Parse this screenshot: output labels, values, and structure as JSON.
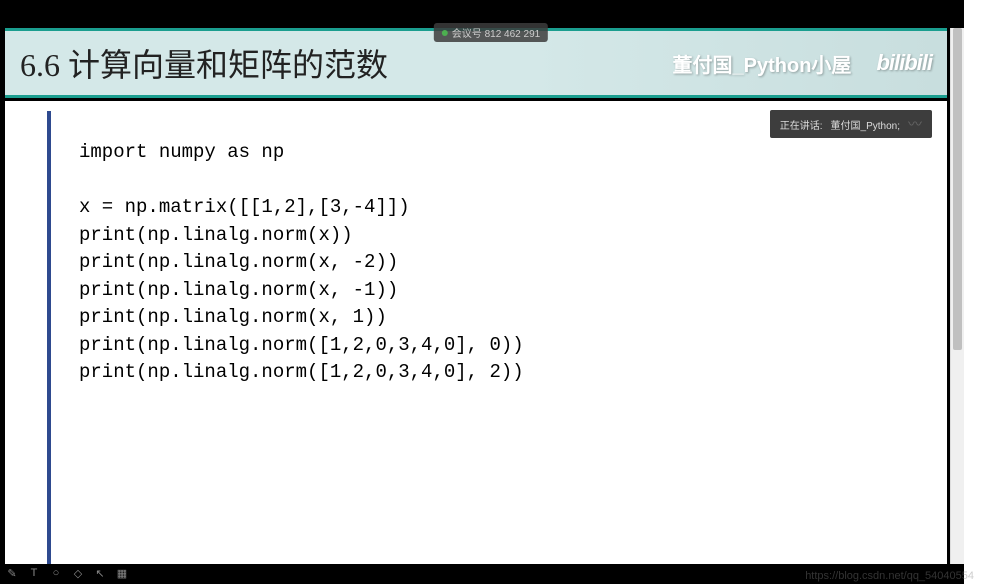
{
  "meeting": {
    "label": "会议号 812 462 291"
  },
  "header": {
    "title": "6.6  计算向量和矩阵的范数",
    "author": "董付国_Python小屋",
    "logo": "bilibili"
  },
  "speaking": {
    "prefix": "正在讲话:",
    "name": "董付国_Python;"
  },
  "code": {
    "content": "import numpy as np\n\nx = np.matrix([[1,2],[3,-4]])\nprint(np.linalg.norm(x))\nprint(np.linalg.norm(x, -2))\nprint(np.linalg.norm(x, -1))\nprint(np.linalg.norm(x, 1))\nprint(np.linalg.norm([1,2,0,3,4,0], 0))\nprint(np.linalg.norm([1,2,0,3,4,0], 2))"
  },
  "watermark": {
    "text": "https://blog.csdn.net/qq_54040554"
  },
  "toolbar": {
    "pen": "✎",
    "text": "T",
    "circle": "○",
    "diamond": "◇",
    "arrow": "↖",
    "image": "▦"
  }
}
